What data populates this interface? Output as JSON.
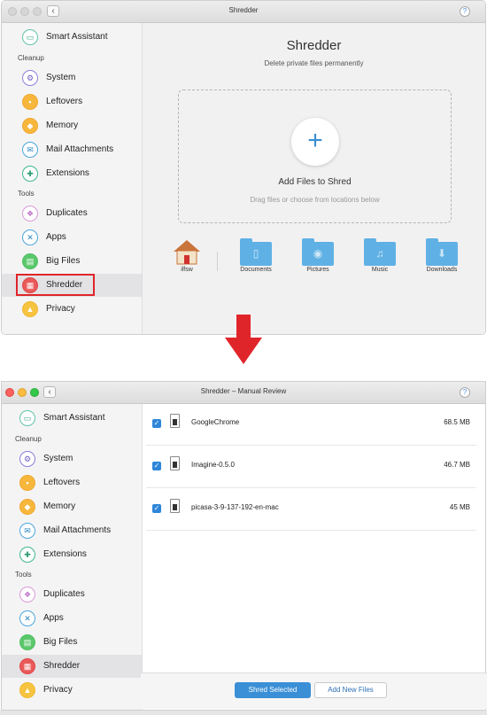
{
  "window1": {
    "title": "Shredder",
    "help": "?",
    "back": "‹",
    "sidebar": {
      "smart_assistant": "Smart Assistant",
      "cleanup_header": "Cleanup",
      "cleanup": [
        "System",
        "Leftovers",
        "Memory",
        "Mail Attachments",
        "Extensions"
      ],
      "tools_header": "Tools",
      "tools": [
        "Duplicates",
        "Apps",
        "Big Files",
        "Shredder",
        "Privacy"
      ]
    },
    "main": {
      "heading": "Shredder",
      "subtitle": "Delete private files permanently",
      "add_icon": "+",
      "add_label": "Add Files to Shred",
      "drag_hint": "Drag files or choose from locations below",
      "locations": [
        "ilfsw",
        "Documents",
        "Pictures",
        "Music",
        "Downloads"
      ]
    }
  },
  "window2": {
    "title": "Shredder – Manual Review",
    "help": "?",
    "back": "‹",
    "sidebar": {
      "smart_assistant": "Smart Assistant",
      "cleanup_header": "Cleanup",
      "cleanup": [
        "System",
        "Leftovers",
        "Memory",
        "Mail Attachments",
        "Extensions"
      ],
      "tools_header": "Tools",
      "tools": [
        "Duplicates",
        "Apps",
        "Big Files",
        "Shredder",
        "Privacy"
      ]
    },
    "files": [
      {
        "name": "GoogleChrome",
        "size": "68.5 MB",
        "checked": true
      },
      {
        "name": "Imagine-0.5.0",
        "size": "46.7 MB",
        "checked": true
      },
      {
        "name": "picasa-3-9-137-192-en-mac",
        "size": "45 MB",
        "checked": true
      }
    ],
    "buttons": {
      "shred": "Shred Selected",
      "add": "Add New Files"
    }
  },
  "colors": {
    "accent": "#3a8fd6",
    "highlight": "#e0252a",
    "arrow": "#e0252a",
    "folder": "#5fb1e5"
  },
  "icons": {
    "check": "✓",
    "home": "home-icon",
    "folder": "folder-icon"
  }
}
